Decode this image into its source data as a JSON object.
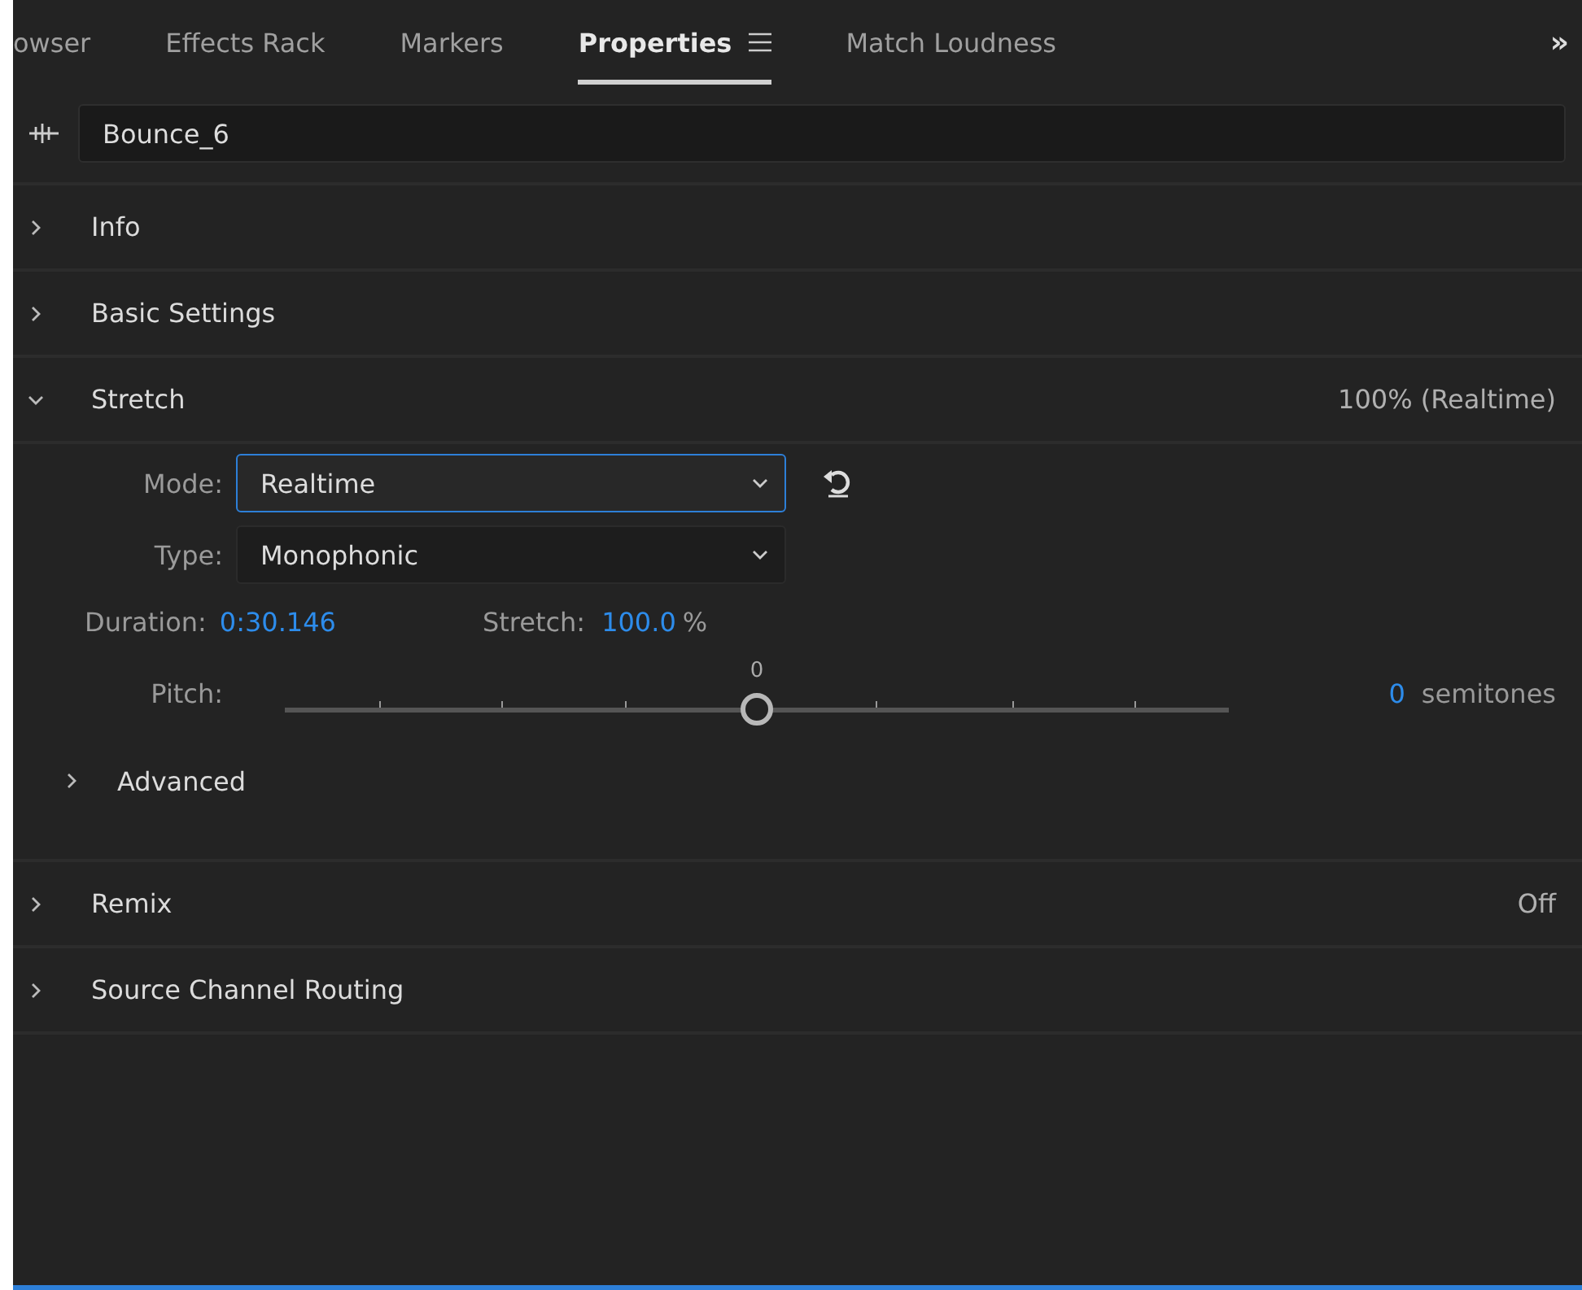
{
  "tabs": [
    {
      "label": "owser",
      "selected": false
    },
    {
      "label": "Effects Rack",
      "selected": false
    },
    {
      "label": "Markers",
      "selected": false
    },
    {
      "label": "Properties",
      "selected": true
    },
    {
      "label": "Match Loudness",
      "selected": false
    }
  ],
  "overflow": "»",
  "clip_name": {
    "value": "Bounce_6"
  },
  "sections": [
    {
      "title": "Info",
      "expanded": false
    },
    {
      "title": "Basic Settings",
      "expanded": false
    },
    {
      "title": "Stretch",
      "expanded": true,
      "summary": "100%  (Realtime)",
      "mode": {
        "label": "Mode:",
        "value": "Realtime",
        "focused": true
      },
      "type": {
        "label": "Type:",
        "value": "Monophonic",
        "focused": false
      },
      "duration": {
        "label": "Duration:",
        "value": "0:30.146"
      },
      "stretch": {
        "label": "Stretch:",
        "value": "100.0",
        "unit": "%"
      },
      "pitch": {
        "label": "Pitch:",
        "thumb_label": "0",
        "level": 0.5,
        "value": "0",
        "unit": "semitones"
      },
      "advanced": {
        "title": "Advanced",
        "expanded": false
      }
    },
    {
      "title": "Remix",
      "expanded": false,
      "summary": "Off"
    },
    {
      "title": "Source Channel Routing",
      "expanded": false
    }
  ]
}
